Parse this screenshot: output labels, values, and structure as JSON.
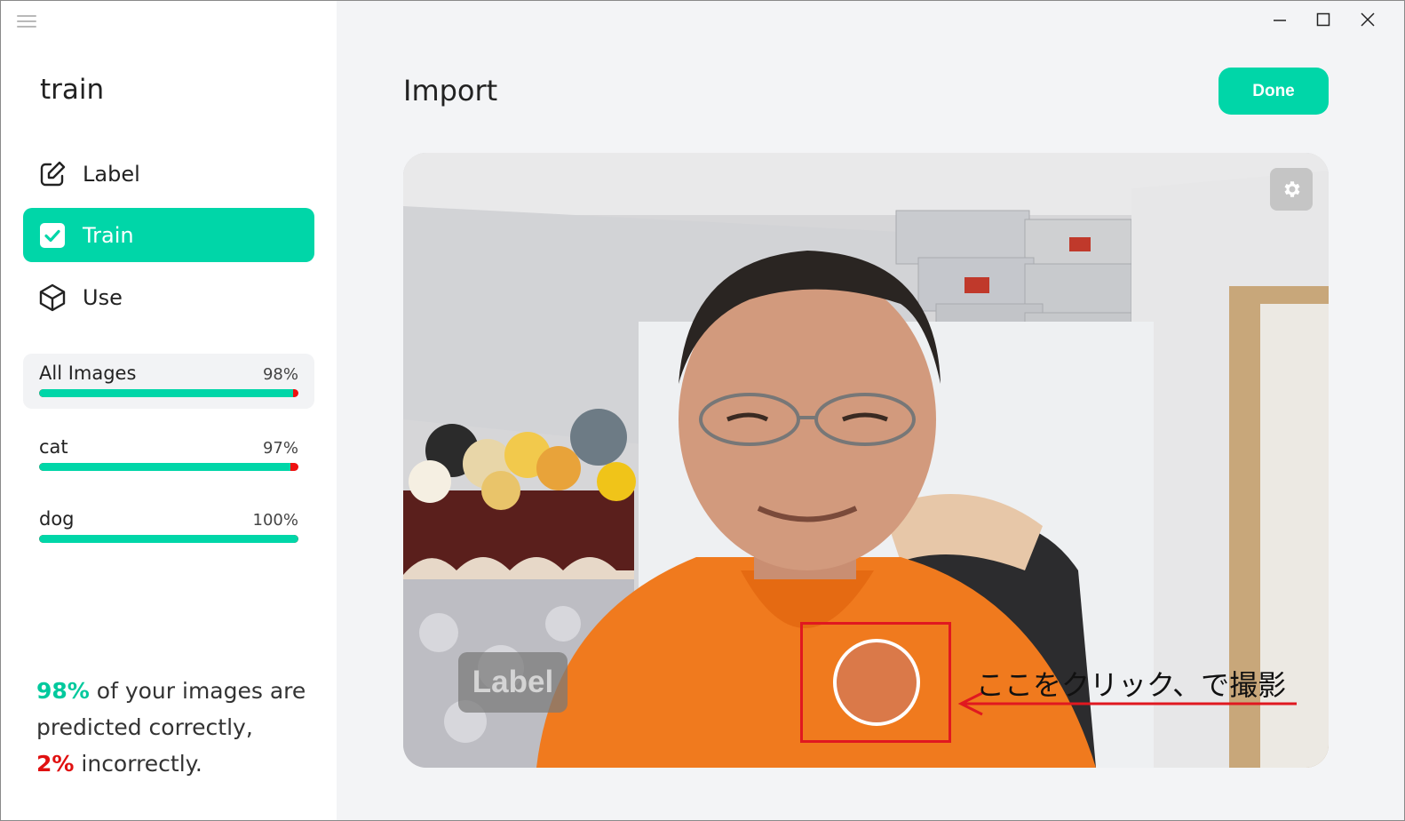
{
  "project": {
    "title": "train"
  },
  "nav": {
    "items": [
      {
        "label": "Label",
        "icon": "pencil-square-icon"
      },
      {
        "label": "Train",
        "icon": "checkbox-icon",
        "active": true
      },
      {
        "label": "Use",
        "icon": "cube-icon"
      }
    ]
  },
  "stats": [
    {
      "name": "All Images",
      "percent_text": "98%",
      "correct_fraction": 0.98
    },
    {
      "name": "cat",
      "percent_text": "97%",
      "correct_fraction": 0.97
    },
    {
      "name": "dog",
      "percent_text": "100%",
      "correct_fraction": 1.0
    }
  ],
  "summary": {
    "correct_pct": "98%",
    "line1": " of your images are",
    "line2": "predicted correctly,",
    "incorrect_pct": "2%",
    "line3": " incorrectly."
  },
  "main": {
    "title": "Import",
    "done_label": "Done",
    "label_button": "Label",
    "annotation": "ここをクリック、で撮影"
  },
  "colors": {
    "accent": "#00d6a8",
    "error": "#e01010",
    "annotation": "#e01820"
  }
}
